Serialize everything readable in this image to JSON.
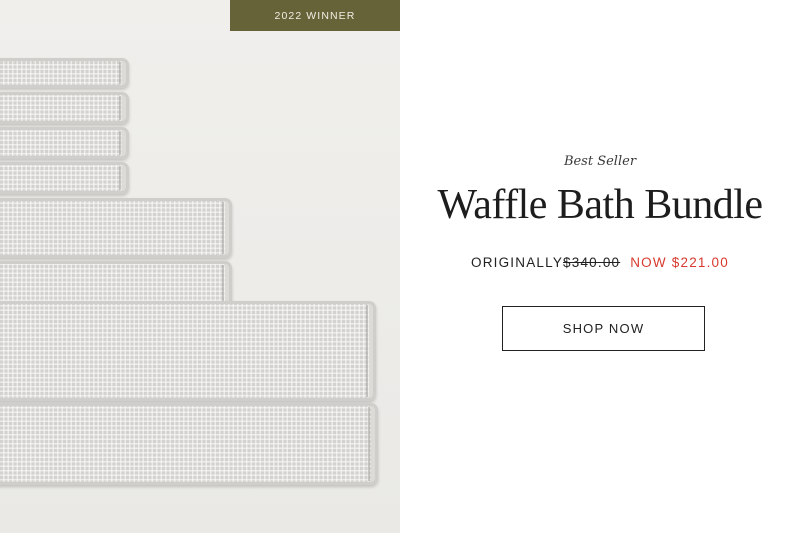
{
  "badge": {
    "text": "2022 WINNER"
  },
  "product": {
    "eyebrow": "Best Seller",
    "title": "Waffle Bath Bundle",
    "original_label": "ORIGINALLY",
    "original_price": "$340.00",
    "now_price": "NOW $221.00",
    "cta": "SHOP NOW"
  },
  "image": {
    "subject": "stacked-waffle-towels"
  },
  "colors": {
    "badge_background": "#666339",
    "sale_price": "#d83a2e",
    "text": "#1d1d1d"
  }
}
